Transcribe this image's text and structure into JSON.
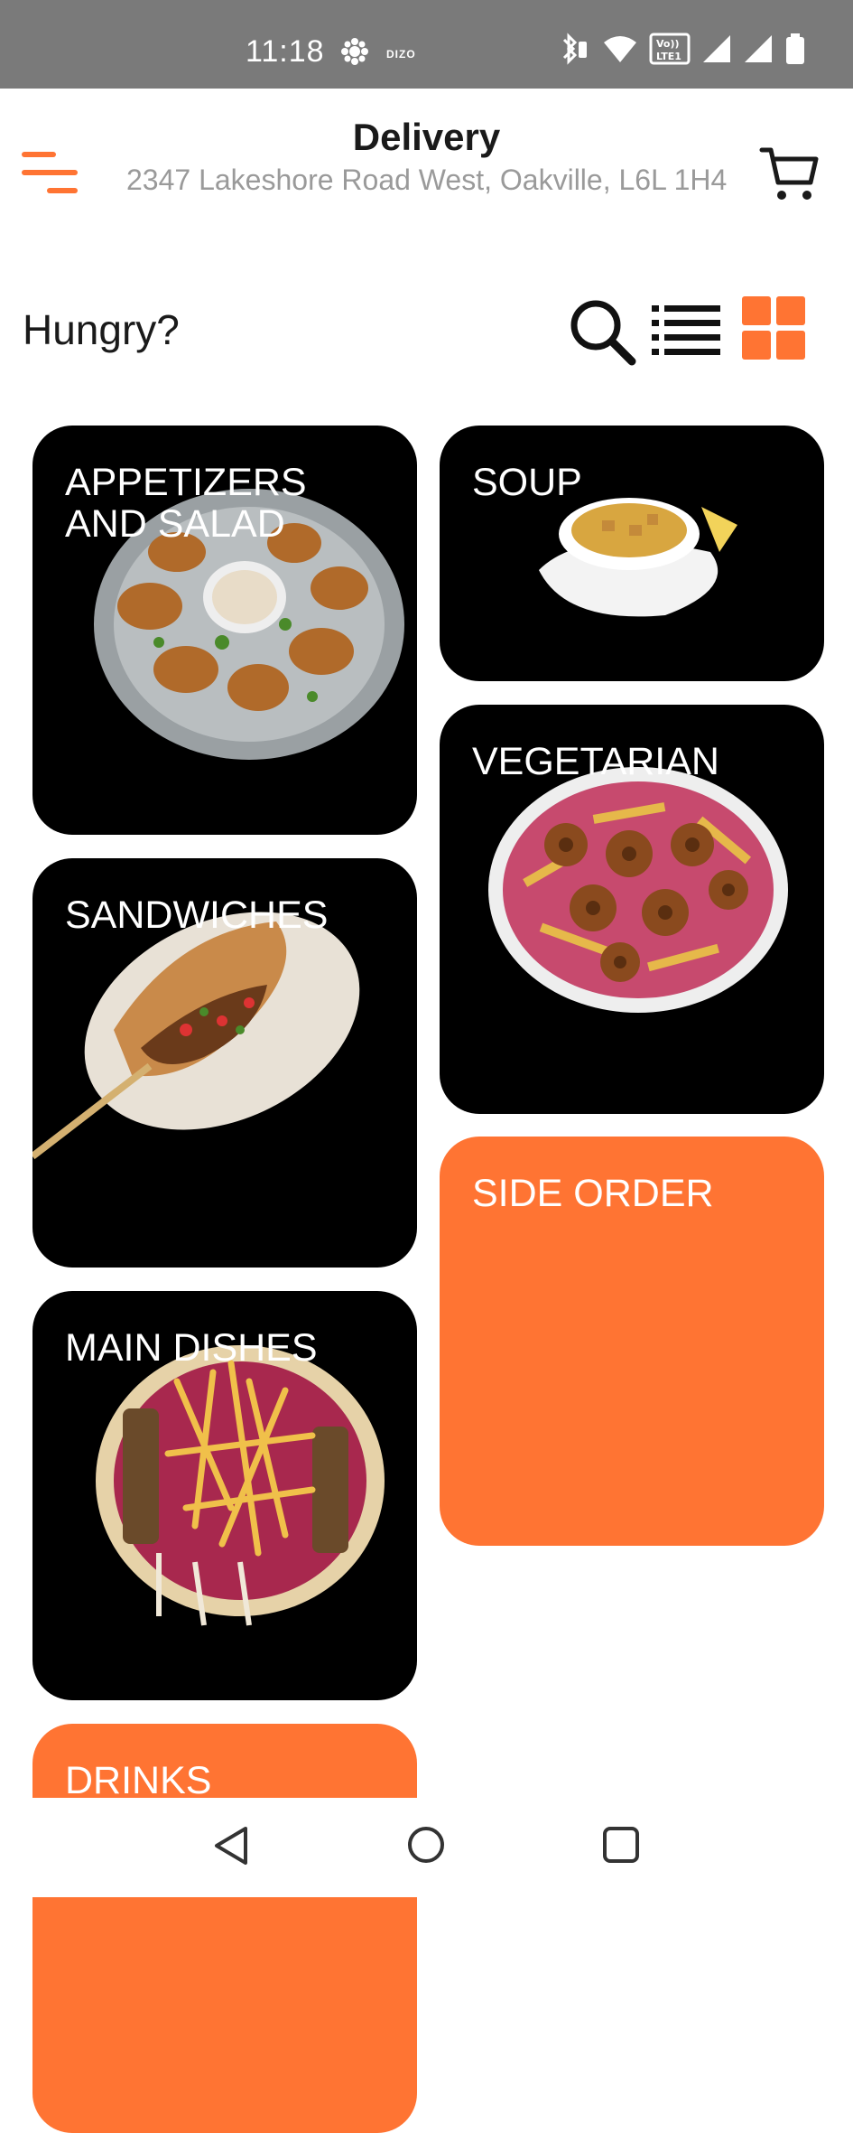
{
  "status_bar": {
    "time": "11:18",
    "brand": "DIZO",
    "icons": [
      "weather-flower-icon",
      "bluetooth-battery-icon",
      "wifi-icon",
      "volte-icon",
      "signal-icon",
      "signal-icon",
      "battery-icon"
    ]
  },
  "header": {
    "title": "Delivery",
    "address": "2347 Lakeshore Road West, Oakville, L6L 1H4",
    "menu_icon": "hamburger-menu-icon",
    "cart_icon": "cart-icon"
  },
  "toolbar": {
    "greeting": "Hungry?",
    "search_icon": "search-icon",
    "list_view_icon": "list-view-icon",
    "grid_view_icon": "grid-view-icon",
    "active_view": "grid"
  },
  "categories": [
    {
      "label": "APPETIZERS AND SALAD",
      "style": "dark"
    },
    {
      "label": "SOUP",
      "style": "dark"
    },
    {
      "label": "VEGETARIAN",
      "style": "dark"
    },
    {
      "label": "SANDWICHES",
      "style": "dark"
    },
    {
      "label": "SIDE ORDER",
      "style": "orange"
    },
    {
      "label": "MAIN DISHES",
      "style": "dark"
    },
    {
      "label": "DRINKS",
      "style": "orange"
    }
  ],
  "colors": {
    "accent": "#ff7433",
    "card_dark": "#000000",
    "status_bar": "#7a7a7a",
    "address_text": "#9a9a9a"
  },
  "nav_bar": {
    "back_icon": "back-triangle-icon",
    "home_icon": "home-circle-icon",
    "recents_icon": "recents-square-icon"
  }
}
